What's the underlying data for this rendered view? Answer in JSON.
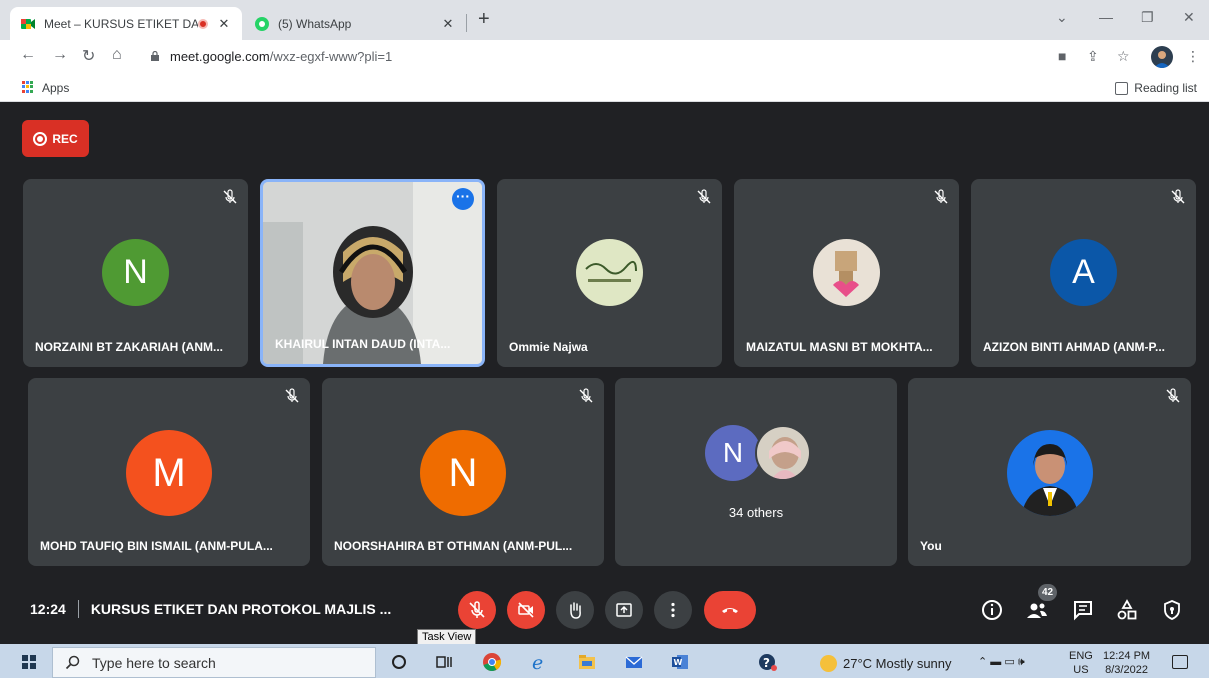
{
  "browser": {
    "tabs": [
      {
        "title": "Meet – KURSUS ETIKET DAN",
        "recording": true,
        "close": "✕"
      },
      {
        "title": "(5) WhatsApp",
        "close": "✕"
      }
    ],
    "new_tab": "+",
    "url_host": "meet.google.com",
    "url_path": "/wxz-egxf-www?pli=1",
    "bookmarks": {
      "apps": "Apps",
      "reading_list": "Reading list"
    }
  },
  "meet": {
    "rec_label": "REC",
    "tiles_row1": [
      {
        "name": "NORZAINI BT ZAKARIAH (ANM...",
        "avatar_letter": "N",
        "avatar_color": "#4f9a33"
      },
      {
        "name": "KHAIRUL INTAN DAUD (INTA...",
        "speaking": true
      },
      {
        "name": "Ommie Najwa"
      },
      {
        "name": "MAIZATUL MASNI BT MOKHTA..."
      },
      {
        "name": "AZIZON BINTI AHMAD (ANM-P...",
        "avatar_letter": "A",
        "avatar_color": "#0b57a8"
      }
    ],
    "tiles_row2": [
      {
        "name": "MOHD TAUFIQ BIN ISMAIL (ANM-PULA...",
        "avatar_letter": "M",
        "avatar_color": "#f4511e"
      },
      {
        "name": "NOORSHAHIRA BT OTHMAN (ANM-PUL...",
        "avatar_letter": "N",
        "avatar_color": "#ef6c00"
      },
      {
        "others_label": "34 others",
        "avatar_letter": "N",
        "avatar_color": "#5c6bc0"
      },
      {
        "name": "You"
      }
    ],
    "time": "12:24",
    "meeting_title": "KURSUS ETIKET DAN PROTOKOL MAJLIS ...",
    "participant_count": "42",
    "tooltip": "Task View"
  },
  "taskbar": {
    "search_placeholder": "Type here to search",
    "weather": "27°C  Mostly sunny",
    "lang_top": "ENG",
    "lang_bottom": "US",
    "time": "12:24 PM",
    "date": "8/3/2022"
  },
  "colors": {
    "meet_bg": "#202124",
    "tile_bg": "#3c4043",
    "danger": "#ea4335",
    "speaking_border": "#8ab4f8"
  }
}
